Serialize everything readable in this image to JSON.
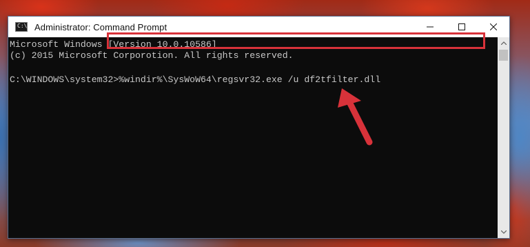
{
  "window": {
    "title": "Administrator: Command Prompt",
    "icon_label": "C:\\"
  },
  "console": {
    "lines": [
      "Microsoft Windows [Version 10.0.10586]",
      "(c) 2015 Microsoft Corporotion. All rights reserved.",
      "",
      "C:\\WINDOWS\\system32>%windir%\\SysWoW64\\regsvr32.exe /u df2tfilter.dll"
    ]
  },
  "annotation": {
    "highlight_color": "#d8323a",
    "arrow_color": "#d8323a"
  },
  "icons": {
    "minimize": "minimize-icon",
    "maximize": "maximize-icon",
    "close": "close-icon",
    "scroll_up": "scroll-up-arrow-icon",
    "scroll_down": "scroll-down-arrow-icon"
  }
}
